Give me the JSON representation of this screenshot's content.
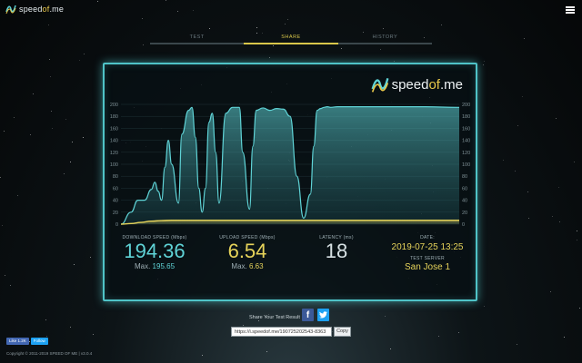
{
  "app": {
    "brand_prefix": "speed",
    "brand_mid": "of",
    "brand_suffix": ".me",
    "menu_icon": "hamburger-icon"
  },
  "tabs": [
    {
      "label": "TEST",
      "active": false
    },
    {
      "label": "SHARE",
      "active": true
    },
    {
      "label": "HISTORY",
      "active": false
    }
  ],
  "chart_data": {
    "type": "area",
    "title": "",
    "xlabel": "",
    "ylabel": "",
    "ylim": [
      0,
      200
    ],
    "y_ticks": [
      0,
      20,
      40,
      60,
      80,
      100,
      120,
      140,
      160,
      180,
      200
    ],
    "series": [
      {
        "color": "#5fd3d6",
        "x": [
          0,
          3,
          5,
          7,
          9,
          10,
          11,
          12,
          13,
          14,
          15,
          17,
          18,
          20,
          21,
          22,
          23,
          24,
          25,
          26,
          27,
          28,
          29,
          31,
          33,
          35,
          36,
          38,
          39,
          40,
          42,
          44,
          46,
          48,
          50,
          52,
          54,
          56,
          57,
          58,
          59,
          60,
          61,
          62,
          64,
          66,
          70,
          80,
          90,
          100
        ],
        "values": [
          0,
          20,
          40,
          40,
          58,
          70,
          55,
          40,
          95,
          140,
          100,
          35,
          150,
          190,
          195,
          145,
          60,
          20,
          60,
          170,
          185,
          120,
          35,
          185,
          195,
          195,
          120,
          25,
          130,
          190,
          194,
          190,
          193,
          192,
          180,
          80,
          10,
          50,
          130,
          190,
          193,
          195,
          196,
          195,
          196,
          196,
          196,
          196,
          196,
          195
        ]
      },
      {
        "color": "#e6d35a",
        "x": [
          0,
          3,
          6,
          9,
          12,
          15,
          20,
          40,
          60,
          80,
          100
        ],
        "values": [
          0,
          1,
          3,
          5,
          6,
          6.5,
          6.5,
          6.5,
          6.6,
          6.6,
          6.6
        ]
      }
    ]
  },
  "stats": {
    "download": {
      "label": "DOWNLOAD SPEED (Mbps)",
      "value": "194.36",
      "max_label": "Max.",
      "max": "195.65"
    },
    "upload": {
      "label": "UPLOAD SPEED (Mbps)",
      "value": "6.54",
      "max_label": "Max.",
      "max": "6.63"
    },
    "latency": {
      "label": "LATENCY (ms)",
      "value": "18"
    },
    "date": {
      "label": "DATE:",
      "value": "2019-07-25 13:25"
    },
    "server": {
      "label": "TEST SERVER",
      "value": "San Jose 1"
    }
  },
  "share": {
    "label": "Share Your Test Result",
    "facebook": "f",
    "twitter": "t",
    "link": "https://i.speedof.me/190725202543-8363",
    "copy": "Copy"
  },
  "footer": {
    "like": "Like 1.2K",
    "follow": "Follow",
    "copyright": "Copyright © 2011-2019 SPEED OF ME | v3.0.4"
  },
  "colors": {
    "accent_teal": "#5fd3d6",
    "accent_yellow": "#e6d35a",
    "panel_border": "#4fc3c7"
  }
}
